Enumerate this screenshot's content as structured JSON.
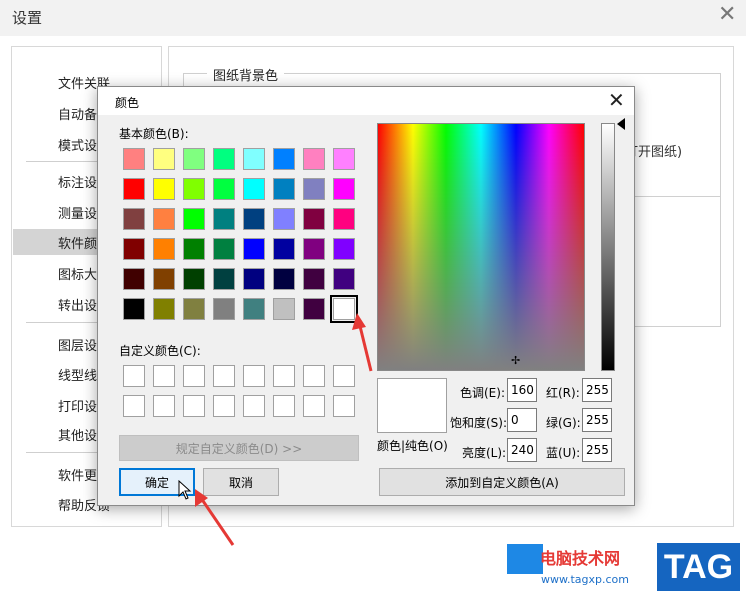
{
  "settings": {
    "title": "设置",
    "close_glyph": "✕",
    "sidebar_items": [
      {
        "label": "文件关联"
      },
      {
        "label": "自动备份"
      },
      {
        "label": "模式设置"
      },
      {
        "label": "标注设置"
      },
      {
        "label": "测量设置"
      },
      {
        "label": "软件颜色"
      },
      {
        "label": "图标大小"
      },
      {
        "label": "转出设置"
      },
      {
        "label": "图层设置"
      },
      {
        "label": "线型线宽"
      },
      {
        "label": "打印设置"
      },
      {
        "label": "其他设置"
      },
      {
        "label": "软件更新"
      },
      {
        "label": "帮助反馈"
      }
    ],
    "selected_item": "软件颜色",
    "group_title": "图纸背景色",
    "partial_text": "打开图纸)"
  },
  "color_dialog": {
    "title": "颜色",
    "close_glyph": "✕",
    "basic_colors_label": "基本颜色(B):",
    "basic_colors": [
      [
        "#ff8080",
        "#ffff80",
        "#80ff80",
        "#00ff80",
        "#80ffff",
        "#0080ff",
        "#ff80c0",
        "#ff80ff"
      ],
      [
        "#ff0000",
        "#ffff00",
        "#80ff00",
        "#00ff40",
        "#00ffff",
        "#0080c0",
        "#8080c0",
        "#ff00ff"
      ],
      [
        "#804040",
        "#ff8040",
        "#00ff00",
        "#008080",
        "#004080",
        "#8080ff",
        "#800040",
        "#ff0080"
      ],
      [
        "#800000",
        "#ff8000",
        "#008000",
        "#008040",
        "#0000ff",
        "#0000a0",
        "#800080",
        "#8000ff"
      ],
      [
        "#400000",
        "#804000",
        "#004000",
        "#004040",
        "#000080",
        "#000040",
        "#400040",
        "#400080"
      ],
      [
        "#000000",
        "#808000",
        "#808040",
        "#808080",
        "#408080",
        "#c0c0c0",
        "#400040",
        "#ffffff"
      ]
    ],
    "selected_color": "#ffffff",
    "custom_colors_label": "自定义颜色(C):",
    "define_custom_button": "规定自定义颜色(D) >>",
    "ok_button": "确定",
    "cancel_button": "取消",
    "preview_label": "颜色|纯色(O)",
    "hue_label": "色调(E):",
    "hue_value": "160",
    "sat_label": "饱和度(S):",
    "sat_value": "0",
    "lum_label": "亮度(L):",
    "lum_value": "240",
    "red_label": "红(R):",
    "red_value": "255",
    "green_label": "绿(G):",
    "green_value": "255",
    "blue_label": "蓝(U):",
    "blue_value": "255",
    "add_custom_button": "添加到自定义颜色(A)"
  },
  "watermark": {
    "site_name": "电脑技术网",
    "url": "www.tagxp.com",
    "tag": "TAG"
  },
  "colors": {
    "accent": "#0078d7",
    "annotation_arrow": "#e53935"
  }
}
